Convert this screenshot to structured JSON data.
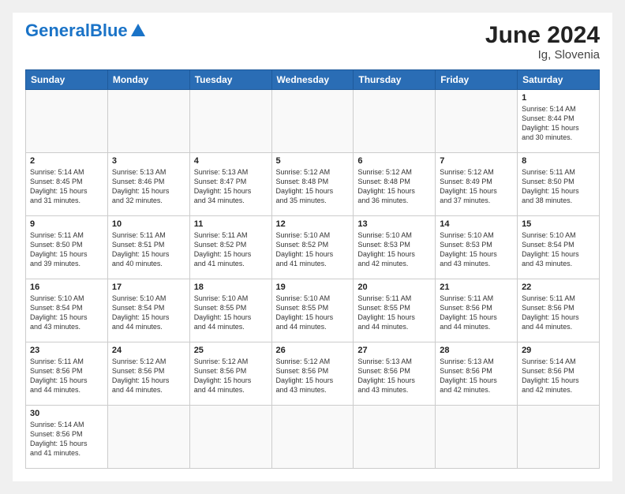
{
  "header": {
    "logo_general": "General",
    "logo_blue": "Blue",
    "month": "June 2024",
    "location": "Ig, Slovenia"
  },
  "weekdays": [
    "Sunday",
    "Monday",
    "Tuesday",
    "Wednesday",
    "Thursday",
    "Friday",
    "Saturday"
  ],
  "weeks": [
    [
      {
        "day": "",
        "info": ""
      },
      {
        "day": "",
        "info": ""
      },
      {
        "day": "",
        "info": ""
      },
      {
        "day": "",
        "info": ""
      },
      {
        "day": "",
        "info": ""
      },
      {
        "day": "",
        "info": ""
      },
      {
        "day": "1",
        "info": "Sunrise: 5:14 AM\nSunset: 8:44 PM\nDaylight: 15 hours\nand 30 minutes."
      }
    ],
    [
      {
        "day": "2",
        "info": "Sunrise: 5:14 AM\nSunset: 8:45 PM\nDaylight: 15 hours\nand 31 minutes."
      },
      {
        "day": "3",
        "info": "Sunrise: 5:13 AM\nSunset: 8:46 PM\nDaylight: 15 hours\nand 32 minutes."
      },
      {
        "day": "4",
        "info": "Sunrise: 5:13 AM\nSunset: 8:47 PM\nDaylight: 15 hours\nand 34 minutes."
      },
      {
        "day": "5",
        "info": "Sunrise: 5:12 AM\nSunset: 8:48 PM\nDaylight: 15 hours\nand 35 minutes."
      },
      {
        "day": "6",
        "info": "Sunrise: 5:12 AM\nSunset: 8:48 PM\nDaylight: 15 hours\nand 36 minutes."
      },
      {
        "day": "7",
        "info": "Sunrise: 5:12 AM\nSunset: 8:49 PM\nDaylight: 15 hours\nand 37 minutes."
      },
      {
        "day": "8",
        "info": "Sunrise: 5:11 AM\nSunset: 8:50 PM\nDaylight: 15 hours\nand 38 minutes."
      }
    ],
    [
      {
        "day": "9",
        "info": "Sunrise: 5:11 AM\nSunset: 8:50 PM\nDaylight: 15 hours\nand 39 minutes."
      },
      {
        "day": "10",
        "info": "Sunrise: 5:11 AM\nSunset: 8:51 PM\nDaylight: 15 hours\nand 40 minutes."
      },
      {
        "day": "11",
        "info": "Sunrise: 5:11 AM\nSunset: 8:52 PM\nDaylight: 15 hours\nand 41 minutes."
      },
      {
        "day": "12",
        "info": "Sunrise: 5:10 AM\nSunset: 8:52 PM\nDaylight: 15 hours\nand 41 minutes."
      },
      {
        "day": "13",
        "info": "Sunrise: 5:10 AM\nSunset: 8:53 PM\nDaylight: 15 hours\nand 42 minutes."
      },
      {
        "day": "14",
        "info": "Sunrise: 5:10 AM\nSunset: 8:53 PM\nDaylight: 15 hours\nand 43 minutes."
      },
      {
        "day": "15",
        "info": "Sunrise: 5:10 AM\nSunset: 8:54 PM\nDaylight: 15 hours\nand 43 minutes."
      }
    ],
    [
      {
        "day": "16",
        "info": "Sunrise: 5:10 AM\nSunset: 8:54 PM\nDaylight: 15 hours\nand 43 minutes."
      },
      {
        "day": "17",
        "info": "Sunrise: 5:10 AM\nSunset: 8:54 PM\nDaylight: 15 hours\nand 44 minutes."
      },
      {
        "day": "18",
        "info": "Sunrise: 5:10 AM\nSunset: 8:55 PM\nDaylight: 15 hours\nand 44 minutes."
      },
      {
        "day": "19",
        "info": "Sunrise: 5:10 AM\nSunset: 8:55 PM\nDaylight: 15 hours\nand 44 minutes."
      },
      {
        "day": "20",
        "info": "Sunrise: 5:11 AM\nSunset: 8:55 PM\nDaylight: 15 hours\nand 44 minutes."
      },
      {
        "day": "21",
        "info": "Sunrise: 5:11 AM\nSunset: 8:56 PM\nDaylight: 15 hours\nand 44 minutes."
      },
      {
        "day": "22",
        "info": "Sunrise: 5:11 AM\nSunset: 8:56 PM\nDaylight: 15 hours\nand 44 minutes."
      }
    ],
    [
      {
        "day": "23",
        "info": "Sunrise: 5:11 AM\nSunset: 8:56 PM\nDaylight: 15 hours\nand 44 minutes."
      },
      {
        "day": "24",
        "info": "Sunrise: 5:12 AM\nSunset: 8:56 PM\nDaylight: 15 hours\nand 44 minutes."
      },
      {
        "day": "25",
        "info": "Sunrise: 5:12 AM\nSunset: 8:56 PM\nDaylight: 15 hours\nand 44 minutes."
      },
      {
        "day": "26",
        "info": "Sunrise: 5:12 AM\nSunset: 8:56 PM\nDaylight: 15 hours\nand 43 minutes."
      },
      {
        "day": "27",
        "info": "Sunrise: 5:13 AM\nSunset: 8:56 PM\nDaylight: 15 hours\nand 43 minutes."
      },
      {
        "day": "28",
        "info": "Sunrise: 5:13 AM\nSunset: 8:56 PM\nDaylight: 15 hours\nand 42 minutes."
      },
      {
        "day": "29",
        "info": "Sunrise: 5:14 AM\nSunset: 8:56 PM\nDaylight: 15 hours\nand 42 minutes."
      }
    ],
    [
      {
        "day": "30",
        "info": "Sunrise: 5:14 AM\nSunset: 8:56 PM\nDaylight: 15 hours\nand 41 minutes."
      },
      {
        "day": "",
        "info": ""
      },
      {
        "day": "",
        "info": ""
      },
      {
        "day": "",
        "info": ""
      },
      {
        "day": "",
        "info": ""
      },
      {
        "day": "",
        "info": ""
      },
      {
        "day": "",
        "info": ""
      }
    ]
  ]
}
